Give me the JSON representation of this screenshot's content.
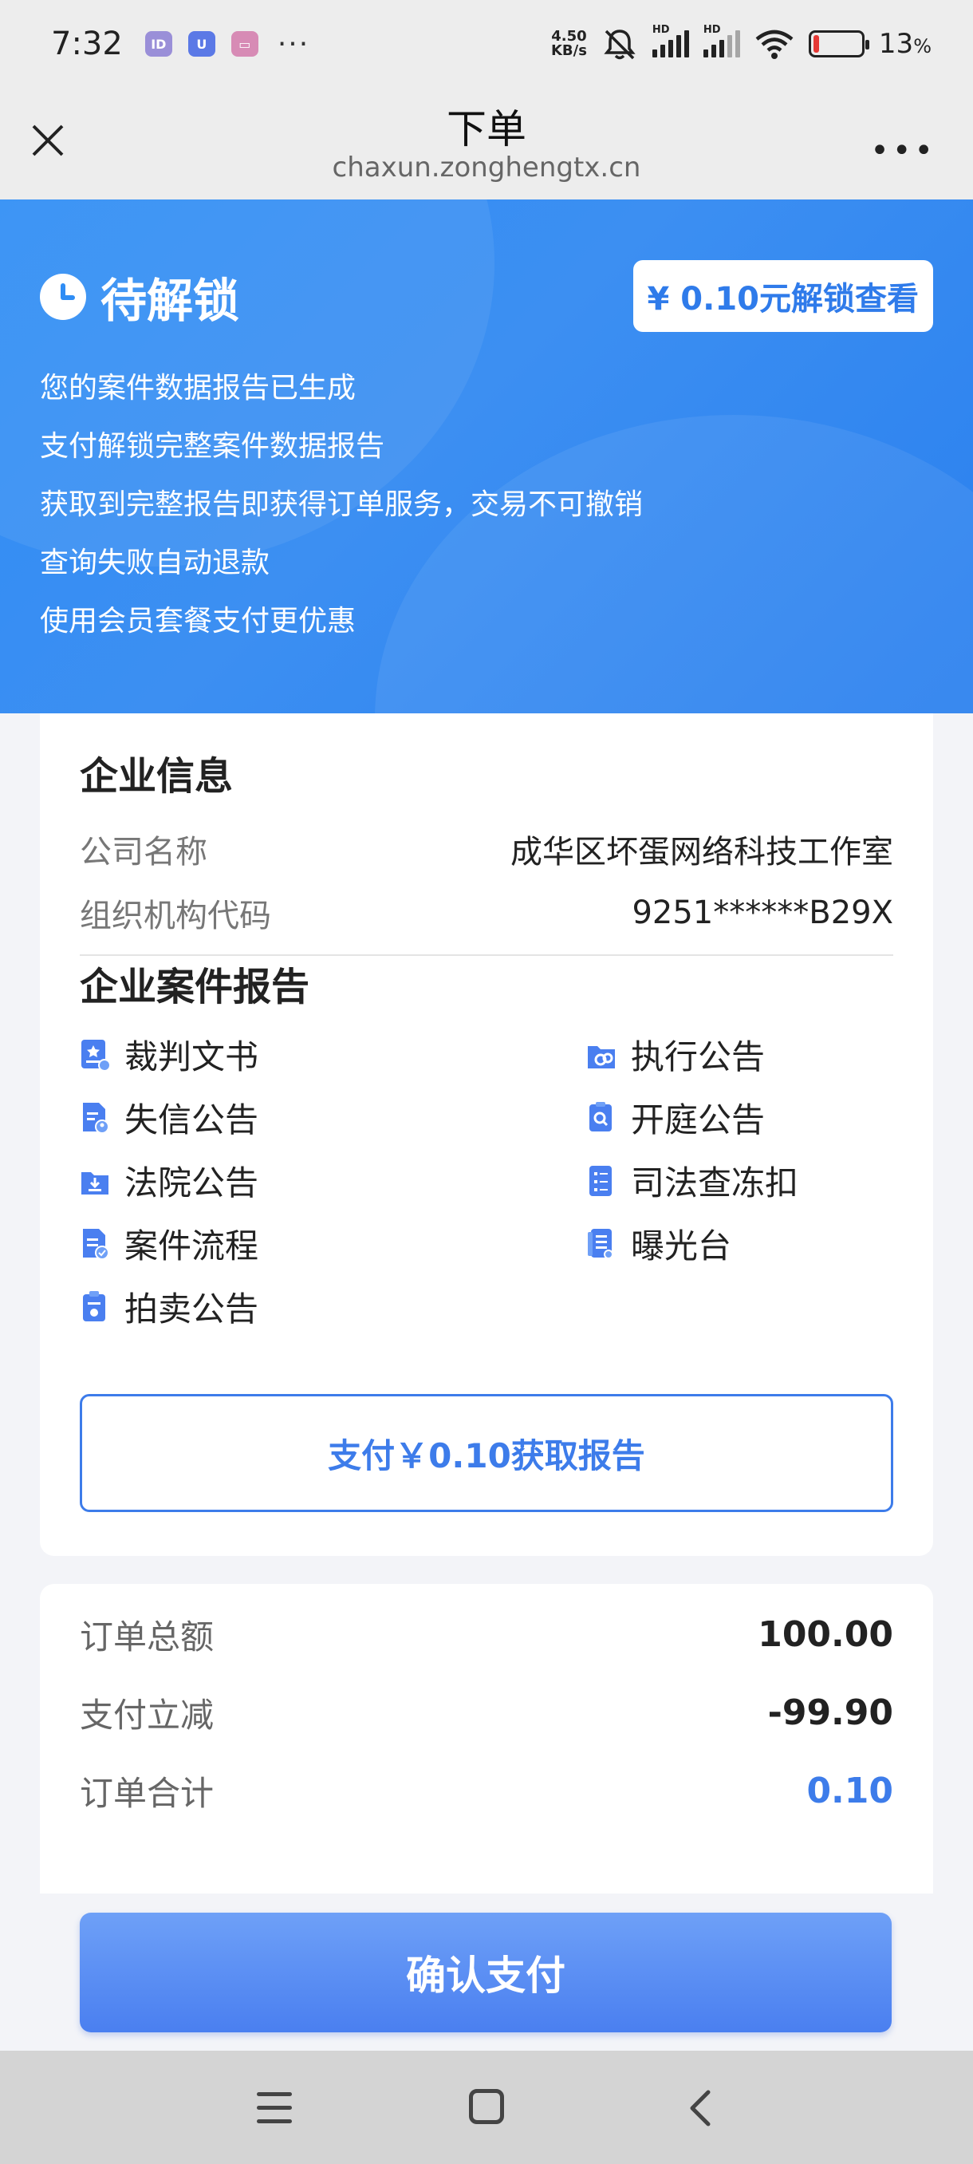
{
  "status_bar": {
    "time": "7:32",
    "net_speed_value": "4.50",
    "net_speed_unit": "KB/s",
    "hd_label": "HD",
    "battery_percent": "13",
    "battery_percent_suffix": "%",
    "battery_level": 0.13,
    "battery_color": "#e53935"
  },
  "title_bar": {
    "title": "下单",
    "url": "chaxun.zonghengtx.cn",
    "close_icon": "close-icon",
    "more_icon": "more-icon"
  },
  "hero": {
    "title": "待解锁",
    "unlock_button": "¥ 0.10元解锁查看",
    "lines": [
      "您的案件数据报告已生成",
      "支付解锁完整案件数据报告",
      "获取到完整报告即获得订单服务，交易不可撤销",
      "查询失败自动退款",
      "使用会员套餐支付更优惠"
    ],
    "bg_color": "#2f8df5"
  },
  "company": {
    "section_title": "企业信息",
    "name_label": "公司名称",
    "name_value": "成华区坏蛋网络科技工作室",
    "code_label": "组织机构代码",
    "code_value": "9251******B29X"
  },
  "reports": {
    "section_title": "企业案件报告",
    "items": [
      {
        "label": "裁判文书",
        "icon": "judgment-doc-icon"
      },
      {
        "label": "执行公告",
        "icon": "execution-folder-icon"
      },
      {
        "label": "失信公告",
        "icon": "dishonesty-doc-icon"
      },
      {
        "label": "开庭公告",
        "icon": "court-search-icon"
      },
      {
        "label": "法院公告",
        "icon": "court-folder-icon"
      },
      {
        "label": "司法查冻扣",
        "icon": "freeze-list-icon"
      },
      {
        "label": "案件流程",
        "icon": "case-flow-icon"
      },
      {
        "label": "曝光台",
        "icon": "exposure-list-icon"
      },
      {
        "label": "拍卖公告",
        "icon": "auction-clipboard-icon"
      }
    ],
    "pay_button": "支付￥0.10获取报告"
  },
  "summary": {
    "total_label": "订单总额",
    "total_value": "100.00",
    "discount_label": "支付立减",
    "discount_value": "-99.90",
    "sum_label": "订单合计",
    "sum_value": "0.10",
    "accent_color": "#3d7cea"
  },
  "confirm_button": "确认支付"
}
